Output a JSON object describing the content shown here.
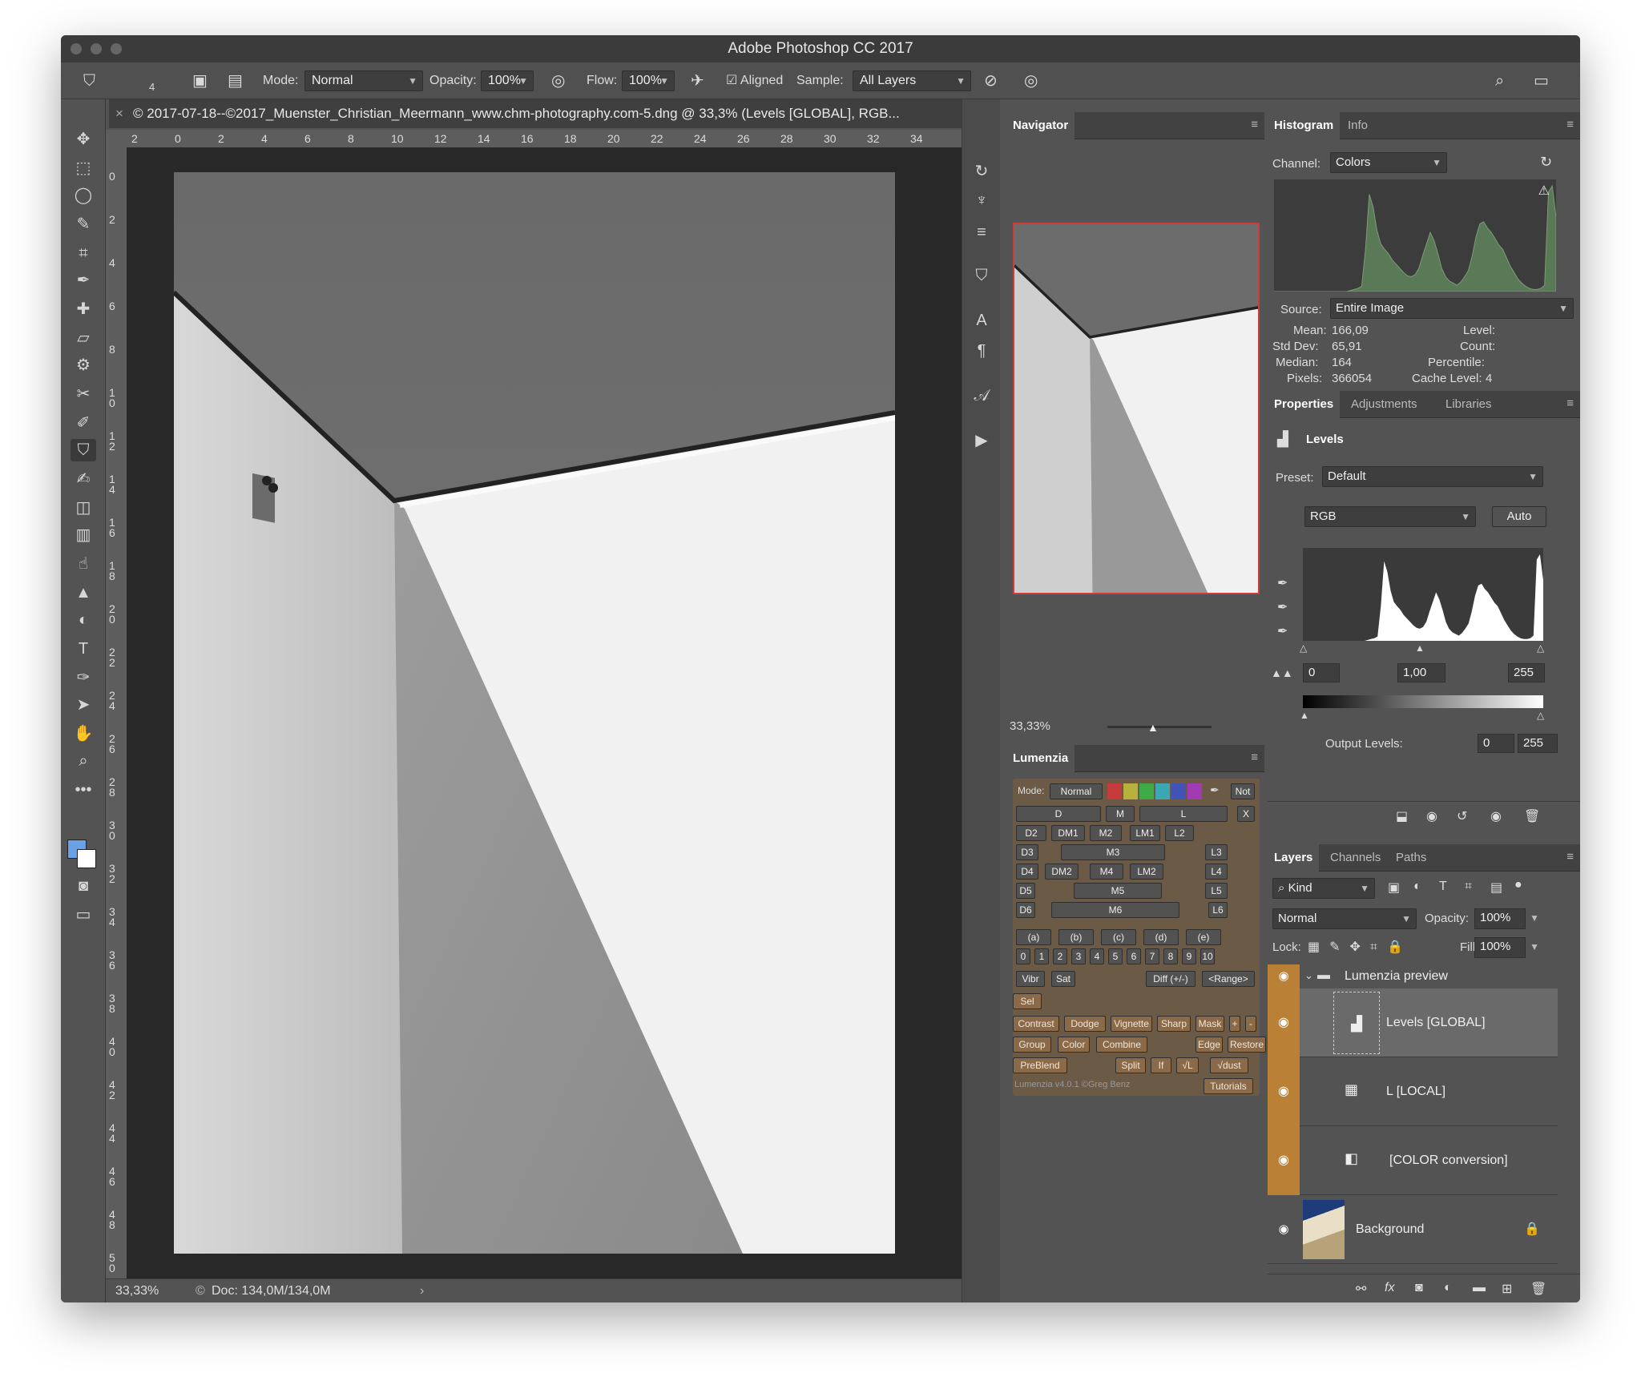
{
  "window": {
    "title": "Adobe Photoshop CC 2017"
  },
  "options": {
    "brush_size": "4",
    "mode_label": "Mode:",
    "mode_value": "Normal",
    "opacity_label": "Opacity:",
    "opacity_value": "100%",
    "flow_label": "Flow:",
    "flow_value": "100%",
    "aligned_label": "Aligned",
    "sample_label": "Sample:",
    "sample_value": "All Layers"
  },
  "document": {
    "tab_title": "© 2017-07-18--©2017_Muenster_Christian_Meermann_www.chm-photography.com-5.dng @ 33,3% (Levels [GLOBAL], RGB...",
    "zoom": "33,33%",
    "doc_info": "Doc: 134,0M/134,0M",
    "ruler_h": [
      "2",
      "0",
      "2",
      "4",
      "6",
      "8",
      "10",
      "12",
      "14",
      "16",
      "18",
      "20",
      "22",
      "24",
      "26",
      "28",
      "30",
      "32",
      "34"
    ],
    "ruler_v": [
      "0",
      "2",
      "4",
      "6",
      "8",
      "10",
      "12",
      "14",
      "16",
      "18",
      "20",
      "22",
      "24",
      "26",
      "28",
      "30",
      "32",
      "34",
      "36",
      "38",
      "40",
      "42",
      "44",
      "46",
      "48",
      "50"
    ]
  },
  "navigator": {
    "title": "Navigator",
    "zoom": "33,33%"
  },
  "histogram": {
    "tabs": [
      "Histogram",
      "Info"
    ],
    "channel_label": "Channel:",
    "channel_value": "Colors",
    "source_label": "Source:",
    "source_value": "Entire Image",
    "mean_label": "Mean:",
    "mean": "166,09",
    "stddev_label": "Std Dev:",
    "stddev": "65,91",
    "median_label": "Median:",
    "median": "164",
    "pixels_label": "Pixels:",
    "pixels": "366054",
    "level_label": "Level:",
    "count_label": "Count:",
    "percentile_label": "Percentile:",
    "cache_label": "Cache Level:",
    "cache": "4"
  },
  "properties": {
    "tabs": [
      "Properties",
      "Adjustments",
      "Libraries"
    ],
    "title": "Levels",
    "preset_label": "Preset:",
    "preset_value": "Default",
    "channel_value": "RGB",
    "auto_label": "Auto",
    "input_black": "0",
    "input_gamma": "1,00",
    "input_white": "255",
    "output_label": "Output Levels:",
    "output_black": "0",
    "output_white": "255"
  },
  "lumenzia": {
    "title": "Lumenzia",
    "mode_label": "Mode:",
    "mode_value": "Normal",
    "not_label": "Not",
    "row1": [
      "D",
      "M",
      "L",
      "X"
    ],
    "row2": [
      "D2",
      "DM1",
      "M2",
      "LM1",
      "L2"
    ],
    "row3": [
      "D3",
      "M3",
      "L3"
    ],
    "row4": [
      "D4",
      "DM2",
      "M4",
      "LM2",
      "L4"
    ],
    "row5": [
      "D5",
      "M5",
      "L5"
    ],
    "row6": [
      "D6",
      "M6",
      "L6"
    ],
    "zones": [
      "(a)",
      "(b)",
      "(c)",
      "(d)",
      "(e)"
    ],
    "digits": [
      "0",
      "1",
      "2",
      "3",
      "4",
      "5",
      "6",
      "7",
      "8",
      "9",
      "10"
    ],
    "vibr": "Vibr",
    "sat": "Sat",
    "diff": "Diff (+/-)",
    "range": "<Range>",
    "sel": "Sel",
    "row_b": [
      "Contrast",
      "Dodge",
      "Vignette",
      "Sharp",
      "Mask",
      "+",
      "-"
    ],
    "row_c": [
      "Group",
      "Color",
      "Combine",
      "Edge",
      "Restore"
    ],
    "row_d": [
      "PreBlend",
      "Split",
      "If",
      "√L",
      "√dust"
    ],
    "credit": "Lumenzia v4.0.1 ©Greg Benz",
    "tutorials": "Tutorials"
  },
  "layers": {
    "tabs": [
      "Layers",
      "Channels",
      "Paths"
    ],
    "kind_label": "Kind",
    "blend_value": "Normal",
    "opacity_label": "Opacity:",
    "opacity_value": "100%",
    "lock_label": "Lock:",
    "fill_label": "Fill:",
    "fill_value": "100%",
    "group_name": "Lumenzia preview",
    "items": [
      "Levels [GLOBAL]",
      "L [LOCAL]",
      "[COLOR conversion]",
      "Background"
    ]
  },
  "histogram_shape": [
    0,
    0,
    0,
    0,
    0,
    0,
    0,
    0,
    0,
    0,
    0,
    0,
    0,
    0,
    0,
    0,
    0,
    0,
    0,
    0,
    1,
    2,
    3,
    5,
    40,
    92,
    80,
    58,
    45,
    40,
    36,
    30,
    26,
    22,
    18,
    15,
    14,
    16,
    22,
    34,
    45,
    56,
    48,
    36,
    22,
    14,
    10,
    8,
    6,
    9,
    14,
    20,
    34,
    52,
    64,
    66,
    60,
    56,
    50,
    44,
    40,
    32,
    24,
    18,
    12,
    8,
    5,
    3,
    2,
    2,
    3,
    6,
    94,
    100,
    70
  ],
  "colors": {
    "accent_eye": "#b98036",
    "lumenzia_brown": "#8a6a48"
  }
}
